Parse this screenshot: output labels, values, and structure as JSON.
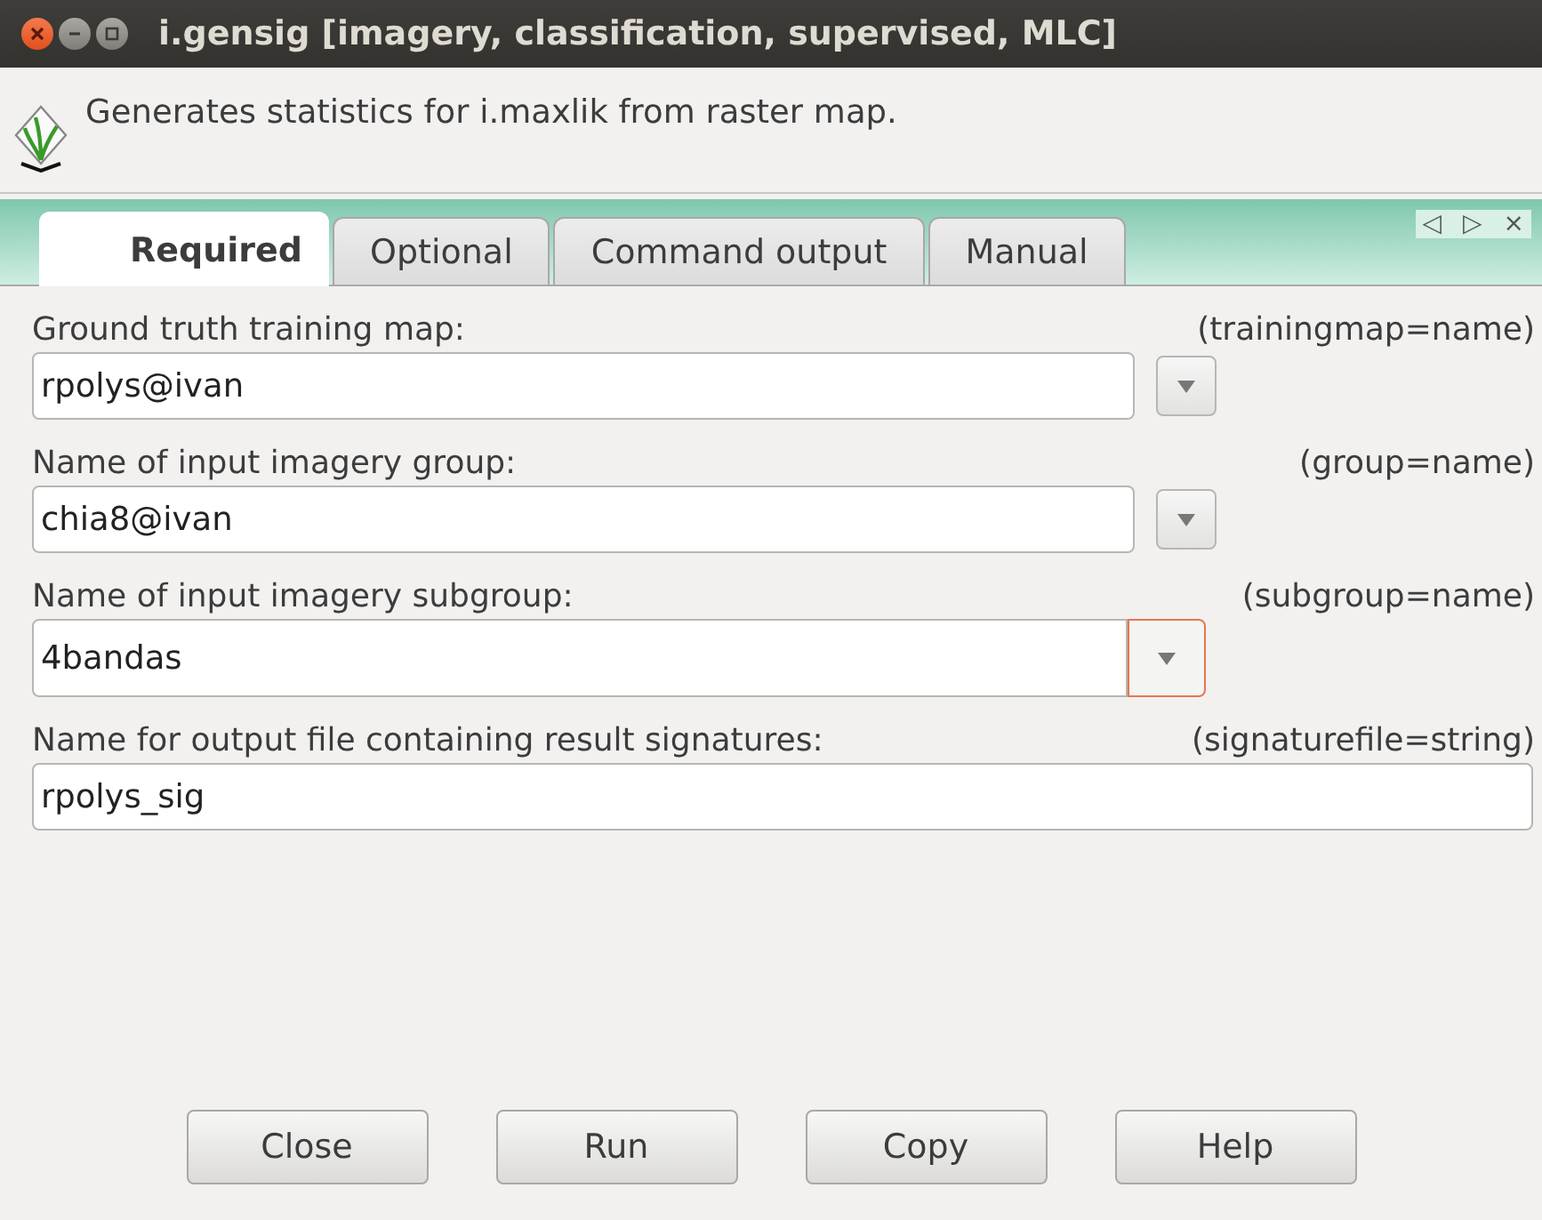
{
  "window": {
    "title": "i.gensig [imagery, classification, supervised, MLC]"
  },
  "description": "Generates statistics for i.maxlik from raster map.",
  "tabs": [
    {
      "label": "Required",
      "selected": true
    },
    {
      "label": "Optional",
      "selected": false
    },
    {
      "label": "Command output",
      "selected": false
    },
    {
      "label": "Manual",
      "selected": false
    }
  ],
  "tab_nav": [
    "◁",
    "▷",
    "×"
  ],
  "fields": [
    {
      "kind": "select",
      "label": "Ground truth training map:",
      "param": "(trainingmap=name)",
      "value": "rpolys@ivan",
      "focused": false
    },
    {
      "kind": "select",
      "label": "Name of input imagery group:",
      "param": "(group=name)",
      "value": "chia8@ivan",
      "focused": false
    },
    {
      "kind": "select",
      "label": "Name of input imagery subgroup:",
      "param": "(subgroup=name)",
      "value": "4bandas",
      "focused": true
    },
    {
      "kind": "text",
      "label": "Name for output file containing result signatures:",
      "param": "(signaturefile=string)",
      "value": "rpolys_sig"
    }
  ],
  "buttons": [
    "Close",
    "Run",
    "Copy",
    "Help"
  ]
}
